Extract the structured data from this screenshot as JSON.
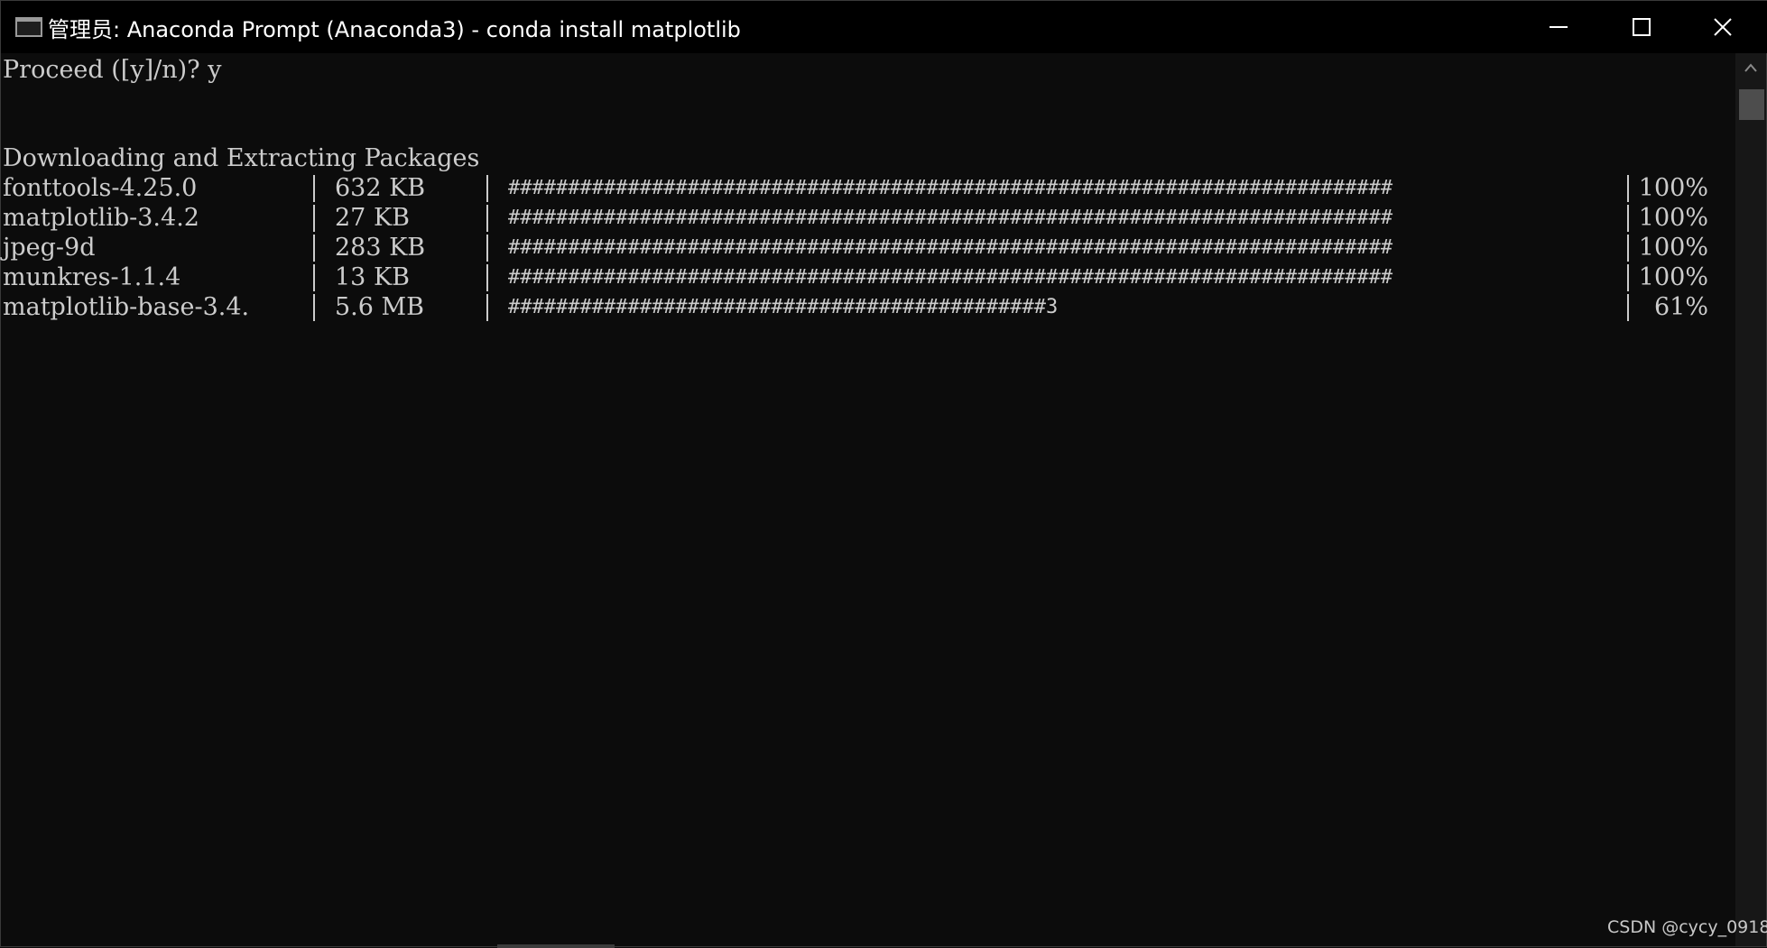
{
  "window": {
    "title": "管理员: Anaconda Prompt (Anaconda3) - conda  install matplotlib",
    "controls": [
      "minimize-icon",
      "maximize-icon",
      "close-icon"
    ]
  },
  "console": {
    "prompt_line": "Proceed ([y]/n)? y",
    "heading": "Downloading and Extracting Packages",
    "packages": [
      {
        "name": "fonttools-4.25.0",
        "size": "632 KB",
        "bar": "##########################################################################",
        "percent": "100%"
      },
      {
        "name": "matplotlib-3.4.2",
        "size": "27 KB",
        "bar": "##########################################################################",
        "percent": "100%"
      },
      {
        "name": "jpeg-9d",
        "size": "283 KB",
        "bar": "##########################################################################",
        "percent": "100%"
      },
      {
        "name": "munkres-1.1.4",
        "size": "13 KB",
        "bar": "##########################################################################",
        "percent": "100%"
      },
      {
        "name": "matplotlib-base-3.4.",
        "size": "5.6 MB",
        "bar": "#############################################3",
        "percent": "61%"
      }
    ]
  },
  "watermark": "CSDN @cycy_0918",
  "colors": {
    "background": "#0c0c0c",
    "text": "#cccccc",
    "titlebar": "#000000"
  }
}
